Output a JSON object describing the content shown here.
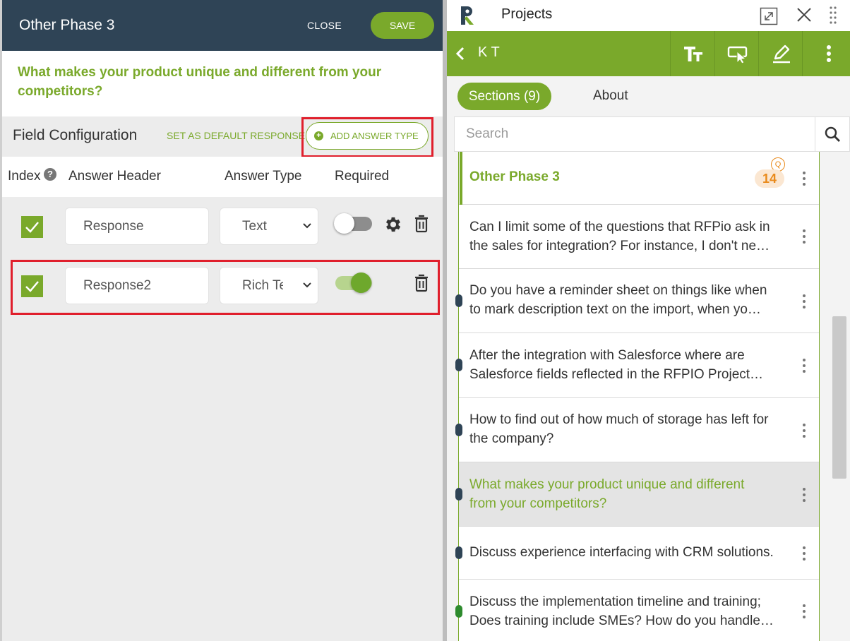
{
  "editor": {
    "title": "Other Phase 3",
    "close_label": "CLOSE",
    "save_label": "SAVE",
    "question": "What makes your product unique and different from your competitors?",
    "field_config_label": "Field Configuration",
    "set_default_label": "SET AS DEFAULT RESPONSE",
    "add_answer_type_label": "ADD ANSWER TYPE",
    "columns": {
      "index": "Index",
      "help": "?",
      "answer_header": "Answer Header",
      "answer_type": "Answer Type",
      "required": "Required"
    },
    "rows": [
      {
        "checked": true,
        "header": "Response",
        "type": "Text",
        "required": false
      },
      {
        "checked": true,
        "header": "Response2",
        "type": "Rich Text",
        "required": true
      }
    ]
  },
  "panel": {
    "app_title": "Projects",
    "project_name": "K T",
    "tabs": [
      "Sections (9)",
      "About"
    ],
    "search_placeholder": "Search",
    "section": {
      "name": "Other Phase 3",
      "q_badge": "Q",
      "count": "14"
    },
    "questions": [
      {
        "line1": "Can I limit some of the questions that RFPio ask in",
        "line2": "the sales for integration? For instance, I don't ne…"
      },
      {
        "line1": "Do you have a reminder sheet on things like when",
        "line2": "to mark description text on the import, when yo…"
      },
      {
        "line1": "After the integration with Salesforce where are",
        "line2": "Salesforce fields reflected in the RFPIO Project…"
      },
      {
        "line1": "How to find out of how much of storage has left for",
        "line2": "the company?"
      },
      {
        "line1": "What makes your product unique and different",
        "line2": "from your competitors?"
      },
      {
        "line1": "Discuss experience interfacing with CRM solutions.",
        "line2": ""
      },
      {
        "line1": "Discuss the implementation timeline and training;",
        "line2": "Does training include SMEs? How do you handle…"
      }
    ],
    "active_index": 4
  },
  "colors": {
    "brand_green": "#7aa92b",
    "header_navy": "#2f4456",
    "highlight_red": "#e01f2c",
    "badge_orange": "#e98a1b"
  }
}
